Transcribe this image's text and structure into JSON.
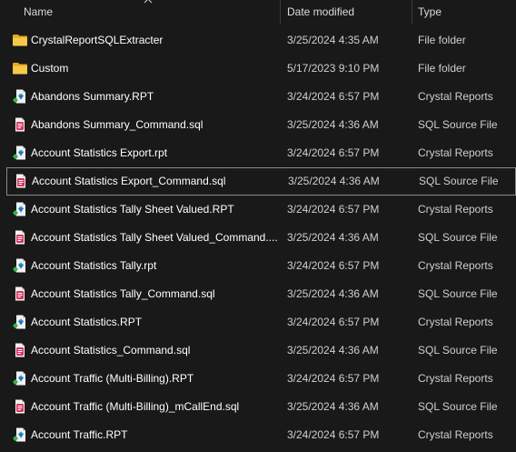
{
  "columns": {
    "name": "Name",
    "date_modified": "Date modified",
    "type": "Type"
  },
  "files": [
    {
      "name": "CrystalReportSQLExtracter",
      "date": "3/25/2024 4:35 AM",
      "type": "File folder",
      "icon": "folder-icon"
    },
    {
      "name": "Custom",
      "date": "5/17/2023 9:10 PM",
      "type": "File folder",
      "icon": "folder-icon"
    },
    {
      "name": "Abandons Summary.RPT",
      "date": "3/24/2024 6:57 PM",
      "type": "Crystal Reports",
      "icon": "crystal-report-icon"
    },
    {
      "name": "Abandons Summary_Command.sql",
      "date": "3/25/2024 4:36 AM",
      "type": "SQL Source File",
      "icon": "sql-file-icon"
    },
    {
      "name": "Account Statistics Export.rpt",
      "date": "3/24/2024 6:57 PM",
      "type": "Crystal Reports",
      "icon": "crystal-report-icon"
    },
    {
      "name": "Account Statistics Export_Command.sql",
      "date": "3/25/2024 4:36 AM",
      "type": "SQL Source File",
      "icon": "sql-file-icon",
      "selected": true
    },
    {
      "name": "Account Statistics Tally Sheet Valued.RPT",
      "date": "3/24/2024 6:57 PM",
      "type": "Crystal Reports",
      "icon": "crystal-report-icon"
    },
    {
      "name": "Account Statistics Tally Sheet Valued_Command....",
      "date": "3/25/2024 4:36 AM",
      "type": "SQL Source File",
      "icon": "sql-file-icon"
    },
    {
      "name": "Account Statistics Tally.rpt",
      "date": "3/24/2024 6:57 PM",
      "type": "Crystal Reports",
      "icon": "crystal-report-icon"
    },
    {
      "name": "Account Statistics Tally_Command.sql",
      "date": "3/25/2024 4:36 AM",
      "type": "SQL Source File",
      "icon": "sql-file-icon"
    },
    {
      "name": "Account Statistics.RPT",
      "date": "3/24/2024 6:57 PM",
      "type": "Crystal Reports",
      "icon": "crystal-report-icon"
    },
    {
      "name": "Account Statistics_Command.sql",
      "date": "3/25/2024 4:36 AM",
      "type": "SQL Source File",
      "icon": "sql-file-icon"
    },
    {
      "name": "Account Traffic (Multi-Billing).RPT",
      "date": "3/24/2024 6:57 PM",
      "type": "Crystal Reports",
      "icon": "crystal-report-icon"
    },
    {
      "name": "Account Traffic (Multi-Billing)_mCallEnd.sql",
      "date": "3/25/2024 4:36 AM",
      "type": "SQL Source File",
      "icon": "sql-file-icon"
    },
    {
      "name": "Account Traffic.RPT",
      "date": "3/24/2024 6:57 PM",
      "type": "Crystal Reports",
      "icon": "crystal-report-icon"
    }
  ],
  "colors": {
    "background": "#191919",
    "folder": "#f4c542",
    "sql_accent": "#d8345f",
    "selection_border": "#8a8a8a"
  }
}
